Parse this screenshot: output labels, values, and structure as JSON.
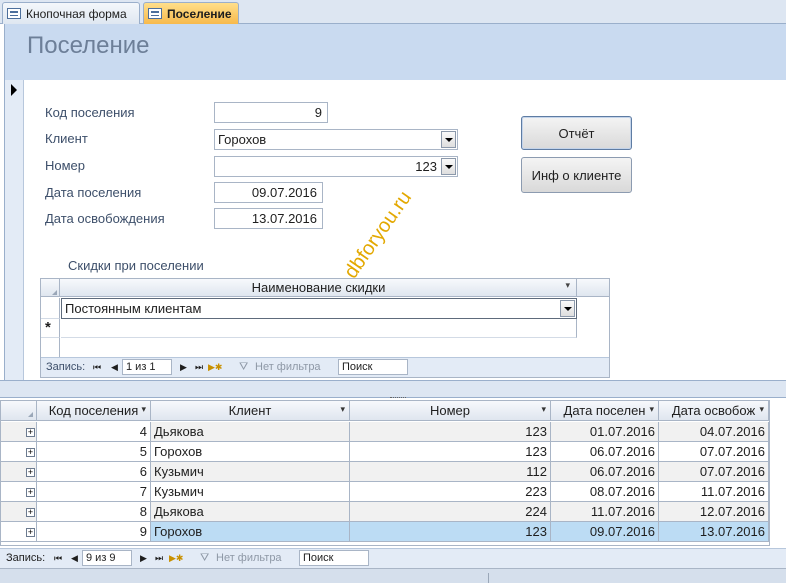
{
  "tabs": [
    {
      "label": "Кнопочная форма"
    },
    {
      "label": "Поселение"
    }
  ],
  "form": {
    "title": "Поселение",
    "fields": {
      "kod": {
        "label": "Код поселения",
        "value": "9"
      },
      "client": {
        "label": "Клиент",
        "value": "Горохов"
      },
      "nomer": {
        "label": "Номер",
        "value": "123"
      },
      "date_in": {
        "label": "Дата поселения",
        "value": "09.07.2016"
      },
      "date_out": {
        "label": "Дата освобождения",
        "value": "13.07.2016"
      }
    },
    "buttons": {
      "report": "Отчёт",
      "client_info": "Инф о клиенте"
    }
  },
  "subform": {
    "title": "Скидки при поселении",
    "column": "Наименование скидки",
    "row_value": "Постоянным клиентам",
    "new_row_marker": "*",
    "nav": {
      "label": "Запись:",
      "position": "1 из 1",
      "filter": "Нет фильтра",
      "search": "Поиск"
    }
  },
  "datasheet": {
    "columns": [
      "Код поселения",
      "Клиент",
      "Номер",
      "Дата поселен",
      "Дата освобож"
    ],
    "rows": [
      [
        "4",
        "Дьякова",
        "123",
        "01.07.2016",
        "04.07.2016"
      ],
      [
        "5",
        "Горохов",
        "123",
        "06.07.2016",
        "07.07.2016"
      ],
      [
        "6",
        "Кузьмич",
        "112",
        "06.07.2016",
        "07.07.2016"
      ],
      [
        "7",
        "Кузьмич",
        "223",
        "08.07.2016",
        "11.07.2016"
      ],
      [
        "8",
        "Дьякова",
        "224",
        "11.07.2016",
        "12.07.2016"
      ],
      [
        "9",
        "Горохов",
        "123",
        "09.07.2016",
        "13.07.2016"
      ]
    ],
    "nav": {
      "label": "Запись:",
      "position": "9 из 9",
      "filter": "Нет фильтра",
      "search": "Поиск"
    }
  },
  "nav_icons": {
    "first": "⏮",
    "prev": "◀",
    "next": "▶",
    "last": "⏭",
    "new": "▶✱"
  },
  "watermark": "dbforyou.ru"
}
